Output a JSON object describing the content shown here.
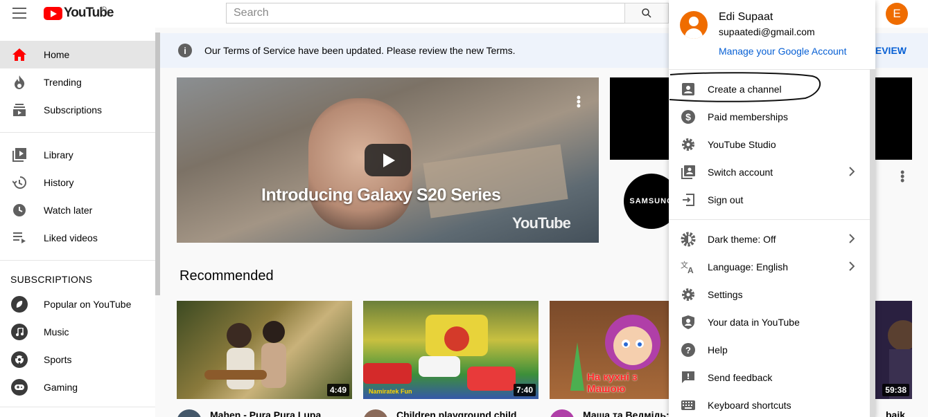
{
  "header": {
    "logo_text": "YouTube",
    "country_code": "ID",
    "search_placeholder": "Search",
    "avatar_initial": "E"
  },
  "sidebar": {
    "main_items": [
      {
        "label": "Home",
        "icon": "home-icon",
        "active": true
      },
      {
        "label": "Trending",
        "icon": "trending-icon"
      },
      {
        "label": "Subscriptions",
        "icon": "subscriptions-icon"
      }
    ],
    "library_items": [
      {
        "label": "Library",
        "icon": "library-icon"
      },
      {
        "label": "History",
        "icon": "history-icon"
      },
      {
        "label": "Watch later",
        "icon": "watch-later-icon"
      },
      {
        "label": "Liked videos",
        "icon": "liked-videos-icon"
      }
    ],
    "subscriptions_heading": "SUBSCRIPTIONS",
    "subscriptions": [
      {
        "label": "Popular on YouTube",
        "icon": "popular-icon"
      },
      {
        "label": "Music",
        "icon": "music-icon"
      },
      {
        "label": "Sports",
        "icon": "sports-icon"
      },
      {
        "label": "Gaming",
        "icon": "gaming-icon"
      }
    ]
  },
  "banner": {
    "text": "Our Terms of Service have been updated. Please review the new Terms.",
    "action": "REVIEW"
  },
  "hero": {
    "title": "Introducing Galaxy S20 Series",
    "watermark": "YouTube"
  },
  "promo": {
    "channel": "SAMSUNG"
  },
  "recommended": {
    "heading": "Recommended",
    "videos": [
      {
        "title": "Mahen - Pura Pura Lupa",
        "duration": "4:49"
      },
      {
        "title": "Children playground child",
        "duration": "7:40"
      },
      {
        "title": "Маша та Ведмідь:",
        "duration": "",
        "overlay": "На кухні з Машою",
        "corner": "Namiratek Fun"
      },
      {
        "title": "baik",
        "duration": "59:38"
      }
    ]
  },
  "account_menu": {
    "name": "Edi Supaat",
    "email": "supaatedi@gmail.com",
    "manage": "Manage your Google Account",
    "group1": [
      {
        "label": "Create a channel",
        "icon": "account-box-icon"
      },
      {
        "label": "Paid memberships",
        "icon": "dollar-icon"
      },
      {
        "label": "YouTube Studio",
        "icon": "gear-icon"
      },
      {
        "label": "Switch account",
        "icon": "switch-account-icon",
        "chevron": true
      },
      {
        "label": "Sign out",
        "icon": "sign-out-icon"
      }
    ],
    "group2": [
      {
        "label": "Dark theme: Off",
        "icon": "dark-theme-icon",
        "chevron": true
      },
      {
        "label": "Language: English",
        "icon": "translate-icon",
        "chevron": true
      },
      {
        "label": "Settings",
        "icon": "settings-icon"
      },
      {
        "label": "Your data in YouTube",
        "icon": "shield-person-icon"
      },
      {
        "label": "Help",
        "icon": "help-icon"
      },
      {
        "label": "Send feedback",
        "icon": "feedback-icon"
      },
      {
        "label": "Keyboard shortcuts",
        "icon": "keyboard-icon"
      }
    ]
  },
  "colors": {
    "brand": "#ff0000",
    "link": "#065fd4",
    "avatar": "#ef6c00"
  }
}
